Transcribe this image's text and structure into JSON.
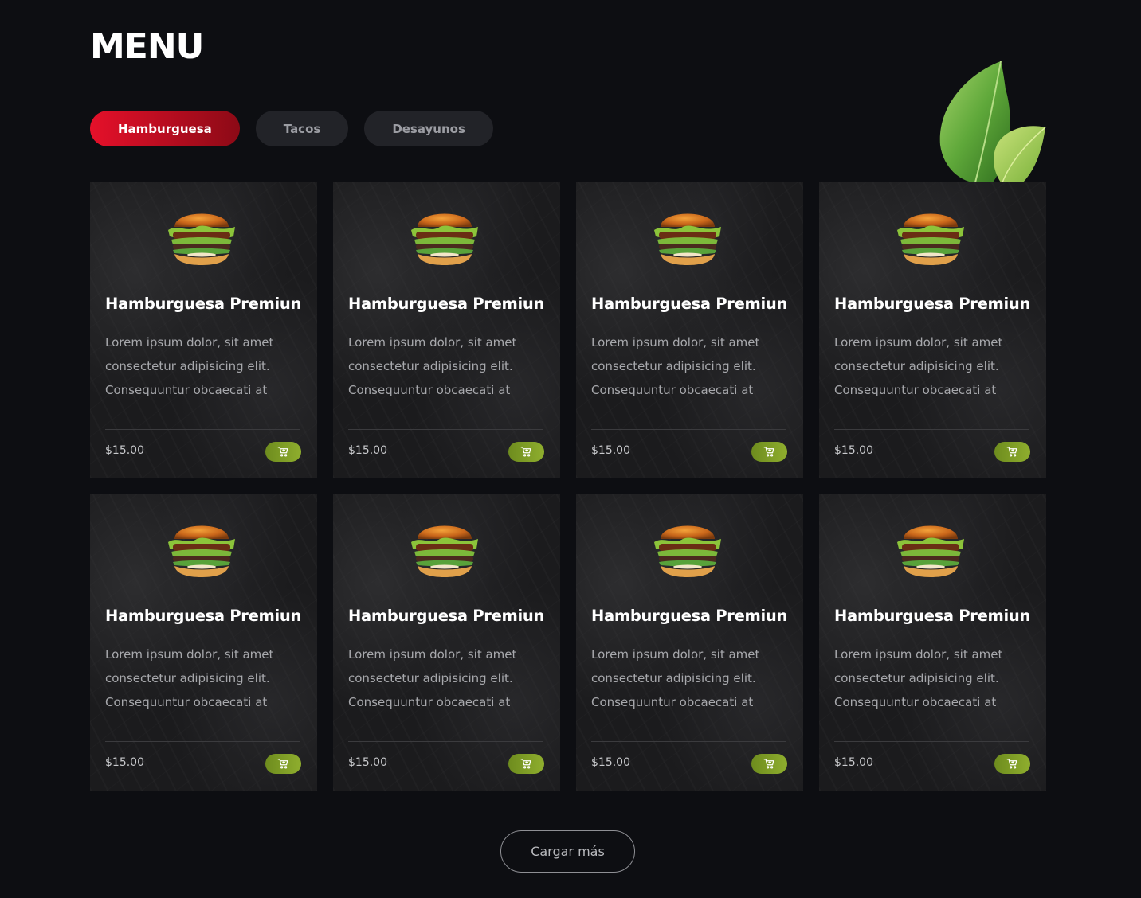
{
  "page": {
    "title": "MENU"
  },
  "tabs": [
    {
      "label": "Hamburguesa",
      "active": true
    },
    {
      "label": "Tacos",
      "active": false
    },
    {
      "label": "Desayunos",
      "active": false
    }
  ],
  "products": [
    {
      "name": "Hamburguesa Premiun",
      "desc": [
        "Lorem ipsum dolor, sit amet",
        "consectetur adipisicing elit.",
        "Consequuntur obcaecati at"
      ],
      "price": "$15.00"
    },
    {
      "name": "Hamburguesa Premiun",
      "desc": [
        "Lorem ipsum dolor, sit amet",
        "consectetur adipisicing elit.",
        "Consequuntur obcaecati at"
      ],
      "price": "$15.00"
    },
    {
      "name": "Hamburguesa Premiun",
      "desc": [
        "Lorem ipsum dolor, sit amet",
        "consectetur adipisicing elit.",
        "Consequuntur obcaecati at"
      ],
      "price": "$15.00"
    },
    {
      "name": "Hamburguesa Premiun",
      "desc": [
        "Lorem ipsum dolor, sit amet",
        "consectetur adipisicing elit.",
        "Consequuntur obcaecati at"
      ],
      "price": "$15.00"
    },
    {
      "name": "Hamburguesa Premiun",
      "desc": [
        "Lorem ipsum dolor, sit amet",
        "consectetur adipisicing elit.",
        "Consequuntur obcaecati at"
      ],
      "price": "$15.00"
    },
    {
      "name": "Hamburguesa Premiun",
      "desc": [
        "Lorem ipsum dolor, sit amet",
        "consectetur adipisicing elit.",
        "Consequuntur obcaecati at"
      ],
      "price": "$15.00"
    },
    {
      "name": "Hamburguesa Premiun",
      "desc": [
        "Lorem ipsum dolor, sit amet",
        "consectetur adipisicing elit.",
        "Consequuntur obcaecati at"
      ],
      "price": "$15.00"
    },
    {
      "name": "Hamburguesa Premiun",
      "desc": [
        "Lorem ipsum dolor, sit amet",
        "consectetur adipisicing elit.",
        "Consequuntur obcaecati at"
      ],
      "price": "$15.00"
    }
  ],
  "icons": {
    "cart": "shopping-cart-icon",
    "decoration": "basil-leaf-icon",
    "product_image": "burger-image"
  },
  "colors": {
    "background": "#0d0e12",
    "accent_red": "#e5102a",
    "accent_green": "#8fae2e",
    "card": "#1b1b1d"
  },
  "load_more": {
    "label": "Cargar más"
  }
}
